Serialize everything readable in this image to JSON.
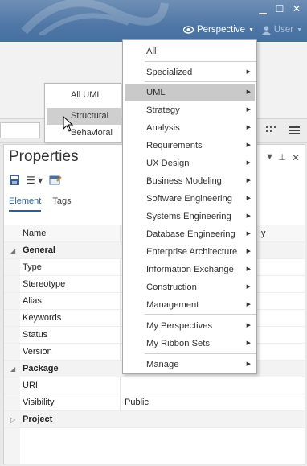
{
  "window": {
    "minimize": "▁",
    "maximize": "☐",
    "close": "✕"
  },
  "header": {
    "perspective_label": "Perspective",
    "user_label": "User"
  },
  "properties": {
    "title": "Properties",
    "tabs": [
      "Element",
      "Tags"
    ],
    "column_name": "Name",
    "column_value_tail": "y",
    "rows": [
      {
        "label": "General",
        "category": true,
        "twisty": "◢"
      },
      {
        "label": "Type",
        "value": ""
      },
      {
        "label": "Stereotype",
        "value": ""
      },
      {
        "label": "Alias",
        "value": ""
      },
      {
        "label": "Keywords",
        "value": ""
      },
      {
        "label": "Status",
        "value": ""
      },
      {
        "label": "Version",
        "value": ""
      },
      {
        "label": "Package",
        "category": true,
        "twisty": "◢"
      },
      {
        "label": "URI",
        "value": ""
      },
      {
        "label": "Visibility",
        "value": "Public"
      },
      {
        "label": "Project",
        "category": true,
        "twisty": "▷"
      }
    ]
  },
  "popup": {
    "items": [
      "All UML",
      "Structural",
      "Behavioral"
    ],
    "selected_index": 1
  },
  "menu": {
    "highlighted_index": 2,
    "items": [
      {
        "label": "All",
        "submenu": false
      },
      {
        "label": "Specialized",
        "submenu": true
      },
      {
        "label": "UML",
        "submenu": true
      },
      {
        "label": "Strategy",
        "submenu": true
      },
      {
        "label": "Analysis",
        "submenu": true
      },
      {
        "label": "Requirements",
        "submenu": true
      },
      {
        "label": "UX Design",
        "submenu": true
      },
      {
        "label": "Business Modeling",
        "submenu": true
      },
      {
        "label": "Software Engineering",
        "submenu": true
      },
      {
        "label": "Systems Engineering",
        "submenu": true
      },
      {
        "label": "Database Engineering",
        "submenu": true
      },
      {
        "label": "Enterprise Architecture",
        "submenu": true
      },
      {
        "label": "Information Exchange",
        "submenu": true
      },
      {
        "label": "Construction",
        "submenu": true
      },
      {
        "label": "Management",
        "submenu": true
      },
      {
        "label": "My Perspectives",
        "submenu": true
      },
      {
        "label": "My Ribbon Sets",
        "submenu": true
      },
      {
        "label": "Manage",
        "submenu": true
      }
    ]
  },
  "colors": {
    "title_band": "#4f77a6",
    "menu_highlight": "#c9c9c9",
    "tab_active": "#2a5d9a"
  }
}
